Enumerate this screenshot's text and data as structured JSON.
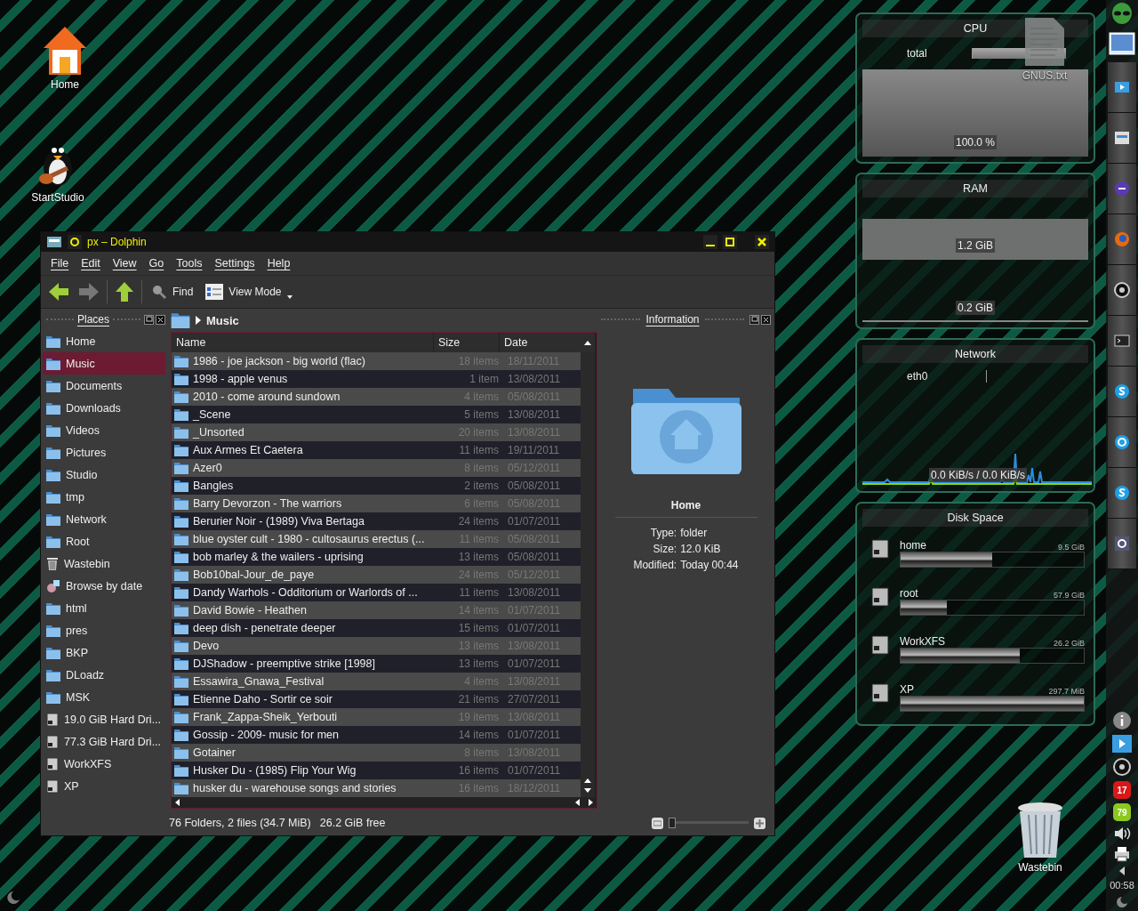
{
  "desktop_icons": [
    {
      "kind": "home",
      "label": "Home"
    },
    {
      "kind": "penguin",
      "label": "StartStudio"
    },
    {
      "kind": "textfile",
      "label": "GNUS.txt"
    },
    {
      "kind": "trash",
      "label": "Wastebin"
    }
  ],
  "window": {
    "title": "px – Dolphin",
    "menu": [
      "File",
      "Edit",
      "View",
      "Go",
      "Tools",
      "Settings",
      "Help"
    ],
    "toolbar": [
      {
        "kind": "back",
        "disabled": false
      },
      {
        "kind": "forward",
        "disabled": true
      },
      {
        "kind": "up",
        "disabled": false
      },
      {
        "kind": "find",
        "label": "Find"
      },
      {
        "kind": "viewmode",
        "label": "View Mode"
      }
    ],
    "places": {
      "title": "Places",
      "items": [
        {
          "kind": "folder",
          "label": "Home",
          "selected": false
        },
        {
          "kind": "folder",
          "label": "Music",
          "selected": true
        },
        {
          "kind": "folder",
          "label": "Documents",
          "selected": false
        },
        {
          "kind": "folder",
          "label": "Downloads",
          "selected": false
        },
        {
          "kind": "folder",
          "label": "Videos",
          "selected": false
        },
        {
          "kind": "folder",
          "label": "Pictures",
          "selected": false
        },
        {
          "kind": "folder",
          "label": "Studio",
          "selected": false
        },
        {
          "kind": "folder",
          "label": "tmp",
          "selected": false
        },
        {
          "kind": "folder",
          "label": "Network",
          "selected": false
        },
        {
          "kind": "folder",
          "label": "Root",
          "selected": false
        },
        {
          "kind": "trash",
          "label": "Wastebin",
          "selected": false
        },
        {
          "kind": "date",
          "label": "Browse by date",
          "selected": false
        },
        {
          "kind": "folder",
          "label": "html",
          "selected": false
        },
        {
          "kind": "folder",
          "label": "pres",
          "selected": false
        },
        {
          "kind": "folder",
          "label": "BKP",
          "selected": false
        },
        {
          "kind": "folder",
          "label": "DLoadz",
          "selected": false
        },
        {
          "kind": "folder",
          "label": "MSK",
          "selected": false
        },
        {
          "kind": "drive",
          "label": "19.0 GiB Hard Dri...",
          "selected": false
        },
        {
          "kind": "drive",
          "label": "77.3 GiB Hard Dri...",
          "selected": false
        },
        {
          "kind": "drive",
          "label": "WorkXFS",
          "selected": false
        },
        {
          "kind": "drive",
          "label": "XP",
          "selected": false
        }
      ]
    },
    "breadcrumb": "Music",
    "table": {
      "columns": [
        "Name",
        "Size",
        "Date"
      ],
      "rows": [
        {
          "name": "1986 - joe jackson - big world (flac)",
          "size": "18 items",
          "date": "18/11/2011"
        },
        {
          "name": "1998 - apple venus",
          "size": "1 item",
          "date": "13/08/2011"
        },
        {
          "name": "2010 - come around sundown",
          "size": "4 items",
          "date": "05/08/2011"
        },
        {
          "name": "_Scene",
          "size": "5 items",
          "date": "13/08/2011"
        },
        {
          "name": "_Unsorted",
          "size": "20 items",
          "date": "13/08/2011"
        },
        {
          "name": "Aux Armes Et Caetera",
          "size": "11 items",
          "date": "19/11/2011"
        },
        {
          "name": "Azer0",
          "size": "8 items",
          "date": "05/12/2011"
        },
        {
          "name": "Bangles",
          "size": "2 items",
          "date": "05/08/2011"
        },
        {
          "name": "Barry Devorzon - The warriors",
          "size": "6 items",
          "date": "05/08/2011"
        },
        {
          "name": "Berurier Noir - (1989) Viva Bertaga",
          "size": "24 items",
          "date": "01/07/2011"
        },
        {
          "name": "blue oyster cult - 1980 - cultosaurus erectus (...",
          "size": "11 items",
          "date": "05/08/2011"
        },
        {
          "name": "bob marley & the wailers - uprising",
          "size": "13 items",
          "date": "05/08/2011"
        },
        {
          "name": "Bob10bal-Jour_de_paye",
          "size": "24 items",
          "date": "05/12/2011"
        },
        {
          "name": "Dandy Warhols - Odditorium or Warlords of ...",
          "size": "11 items",
          "date": "13/08/2011"
        },
        {
          "name": "David Bowie - Heathen",
          "size": "14 items",
          "date": "01/07/2011"
        },
        {
          "name": "deep dish - penetrate deeper",
          "size": "15 items",
          "date": "01/07/2011"
        },
        {
          "name": "Devo",
          "size": "13 items",
          "date": "13/08/2011"
        },
        {
          "name": "DJShadow - preemptive strike [1998]",
          "size": "13 items",
          "date": "01/07/2011"
        },
        {
          "name": "Essawira_Gnawa_Festival",
          "size": "4 items",
          "date": "13/08/2011"
        },
        {
          "name": "Etienne Daho - Sortir ce soir",
          "size": "21 items",
          "date": "27/07/2011"
        },
        {
          "name": "Frank_Zappa-Sheik_Yerbouti",
          "size": "19 items",
          "date": "13/08/2011"
        },
        {
          "name": "Gossip - 2009- music for men",
          "size": "14 items",
          "date": "01/07/2011"
        },
        {
          "name": "Gotainer",
          "size": "8 items",
          "date": "13/08/2011"
        },
        {
          "name": "Husker Du - (1985) Flip Your Wig",
          "size": "16 items",
          "date": "01/07/2011"
        },
        {
          "name": "husker du - warehouse songs and stories",
          "size": "16 items",
          "date": "18/12/2011"
        }
      ]
    },
    "information": {
      "title": "Information",
      "name": "Home",
      "fields": [
        {
          "label": "Type:",
          "value": "folder"
        },
        {
          "label": "Size:",
          "value": "12.0 KiB"
        },
        {
          "label": "Modified:",
          "value": "Today 00:44"
        }
      ]
    },
    "status_bar": {
      "summary": "76 Folders, 2 files (34.7 MiB)",
      "free": "26.2 GiB free",
      "zoom": {
        "level": 0.0
      }
    }
  },
  "widgets": {
    "cpu": {
      "title": "CPU",
      "label": "total",
      "level": 0.83,
      "reading": "100.0 %"
    },
    "ram": {
      "title": "RAM",
      "readings": [
        "1.2 GiB",
        "0.2 GiB"
      ]
    },
    "network": {
      "title": "Network",
      "interface": "eth0",
      "reading": "0.0 KiB/s / 0.0 KiB/s"
    },
    "disk": {
      "title": "Disk Space",
      "items": [
        {
          "name": "home",
          "size": "9.5 GiB",
          "level": 0.5
        },
        {
          "name": "root",
          "size": "57.9 GiB",
          "level": 0.25
        },
        {
          "name": "WorkXFS",
          "size": "26.2 GiB",
          "level": 0.65
        },
        {
          "name": "XP",
          "size": "297.7 MiB",
          "level": 1.0
        }
      ]
    }
  },
  "panel": {
    "badges": [
      "17",
      "79"
    ],
    "clock": "00:58"
  }
}
